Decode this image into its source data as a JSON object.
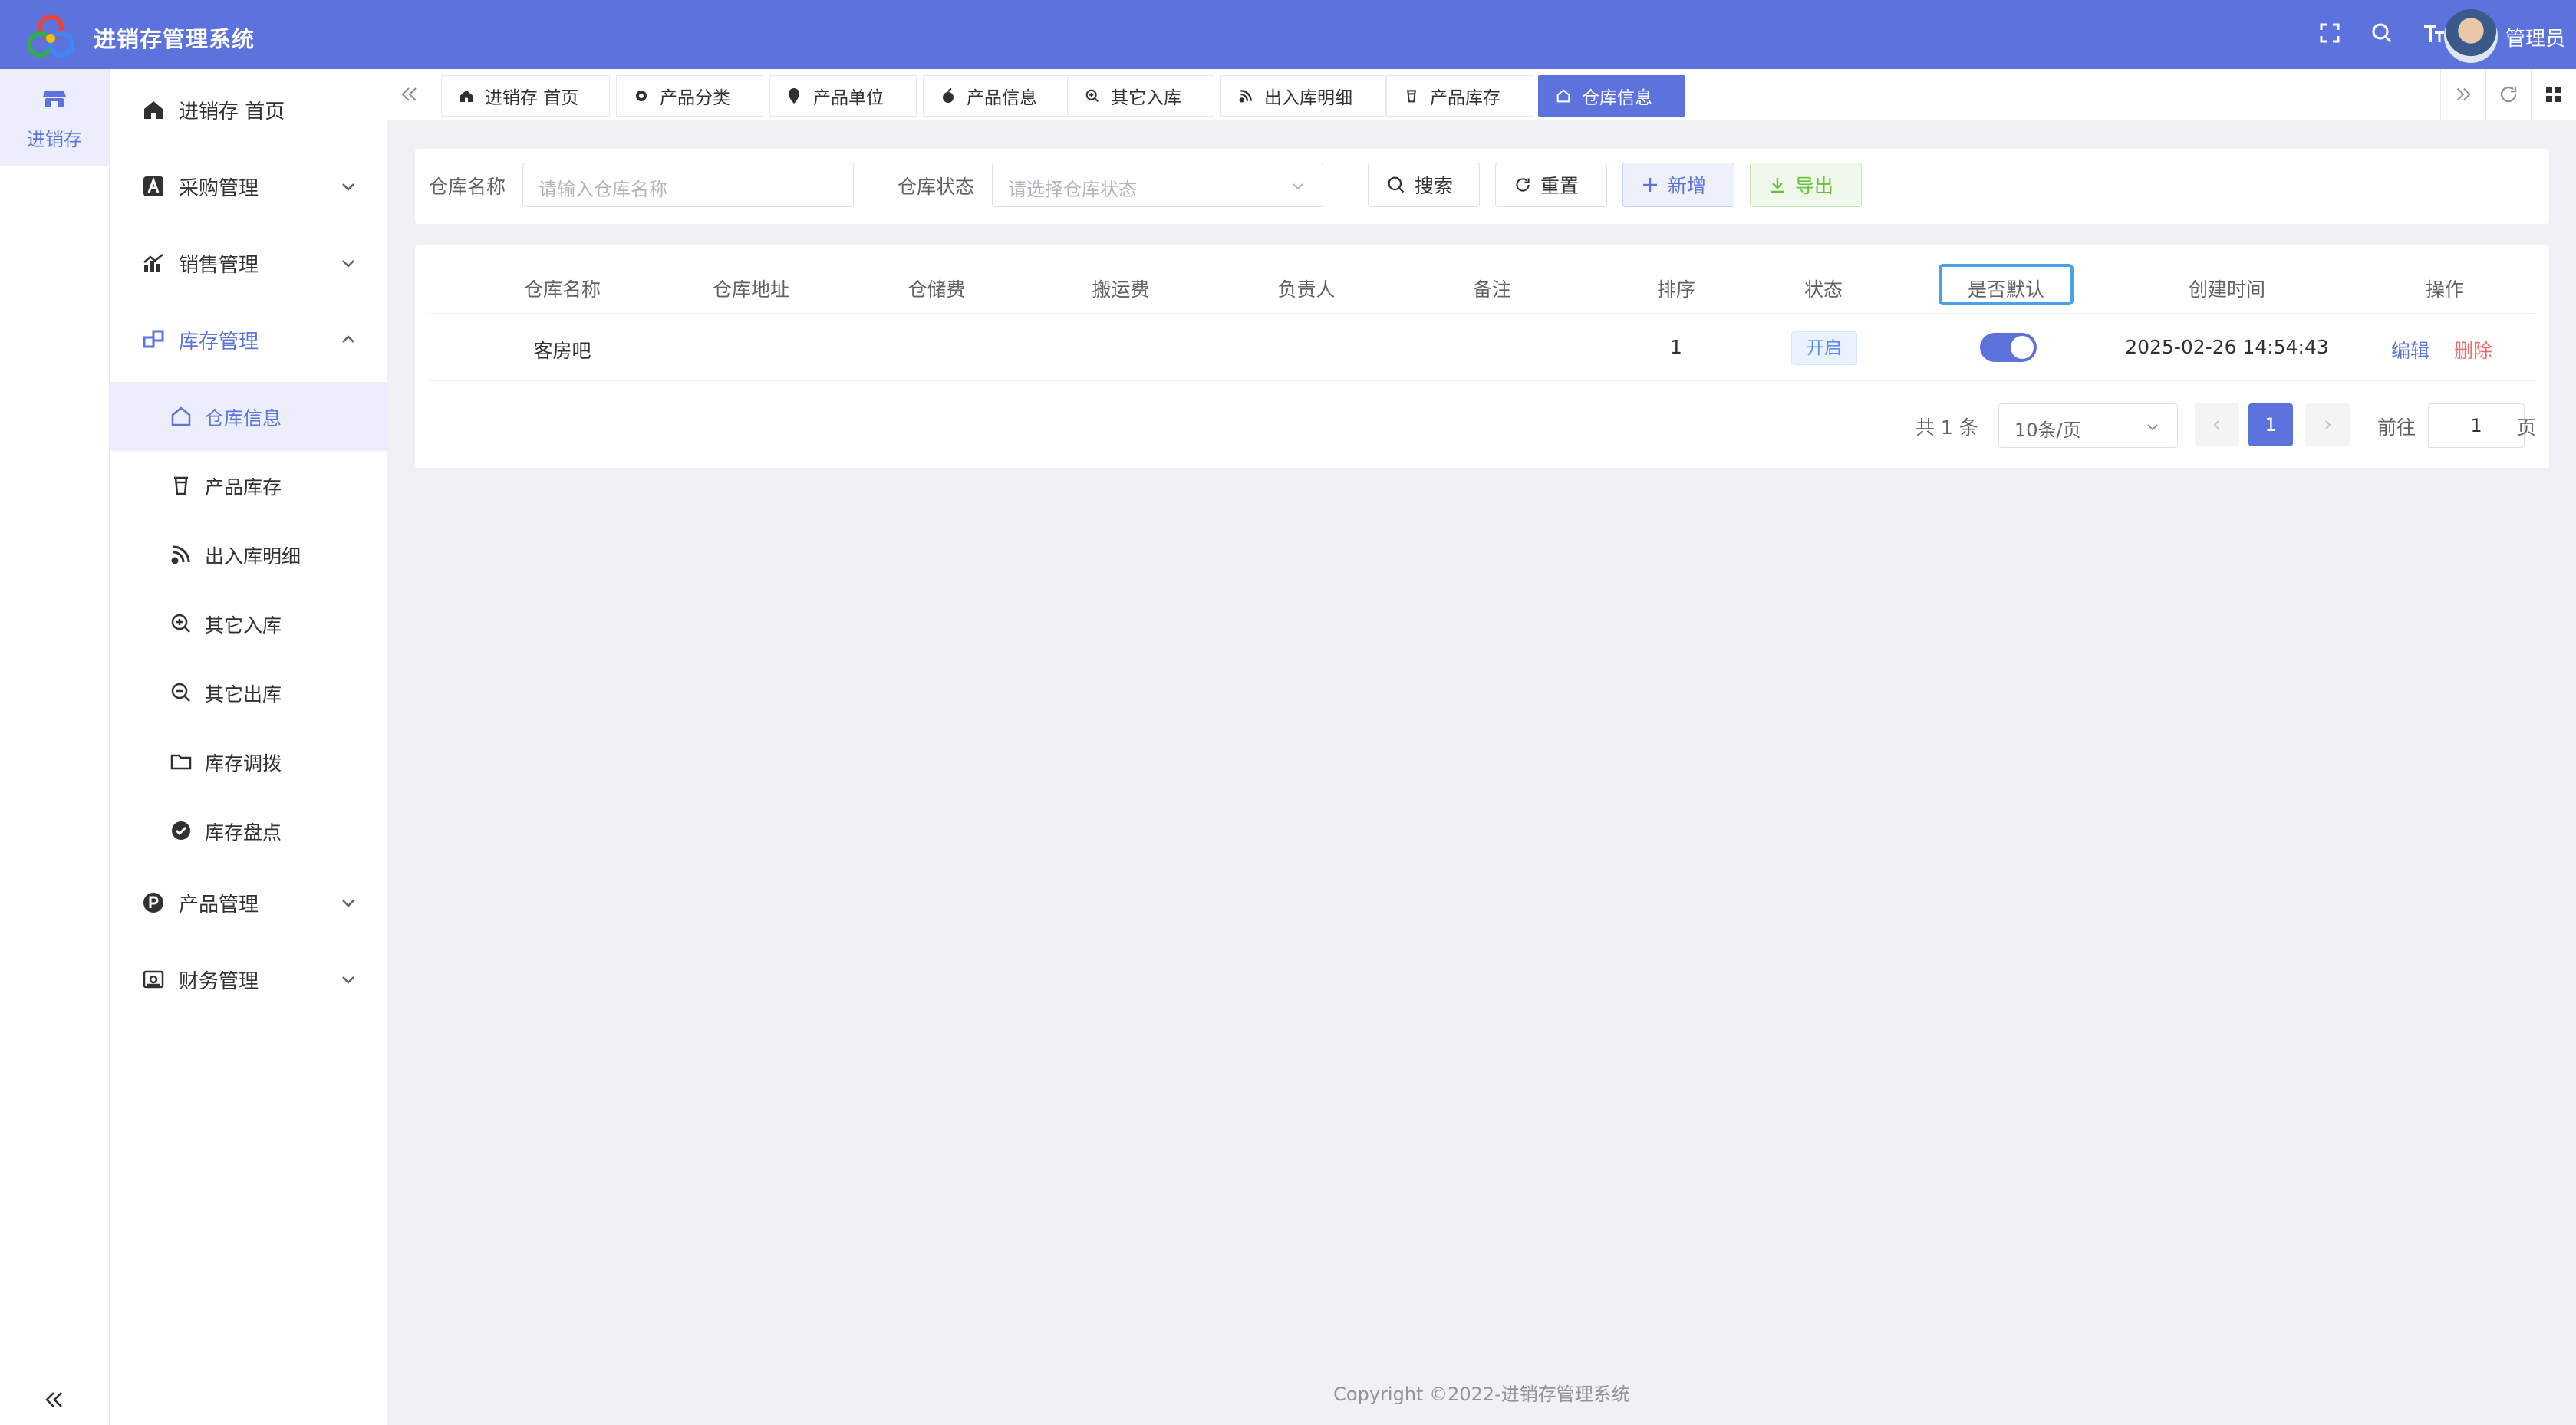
{
  "app": {
    "title": "进销存管理系统",
    "user": "管理员"
  },
  "rail": {
    "label": "进销存"
  },
  "sidebar": {
    "items": [
      {
        "label": "进销存 首页"
      },
      {
        "label": "采购管理"
      },
      {
        "label": "销售管理"
      },
      {
        "label": "库存管理"
      },
      {
        "label": "产品管理"
      },
      {
        "label": "财务管理"
      }
    ],
    "sub_items": [
      {
        "label": "仓库信息"
      },
      {
        "label": "产品库存"
      },
      {
        "label": "出入库明细"
      },
      {
        "label": "其它入库"
      },
      {
        "label": "其它出库"
      },
      {
        "label": "库存调拨"
      },
      {
        "label": "库存盘点"
      }
    ]
  },
  "tabs": [
    {
      "label": "进销存 首页"
    },
    {
      "label": "产品分类"
    },
    {
      "label": "产品单位"
    },
    {
      "label": "产品信息"
    },
    {
      "label": "其它入库"
    },
    {
      "label": "出入库明细"
    },
    {
      "label": "产品库存"
    },
    {
      "label": "仓库信息"
    }
  ],
  "search": {
    "name_label": "仓库名称",
    "name_placeholder": "请输入仓库名称",
    "status_label": "仓库状态",
    "status_placeholder": "请选择仓库状态",
    "search_btn": "搜索",
    "reset_btn": "重置",
    "add_btn": "新增",
    "export_btn": "导出"
  },
  "table": {
    "headers": [
      "仓库名称",
      "仓库地址",
      "仓储费",
      "搬运费",
      "负责人",
      "备注",
      "排序",
      "状态",
      "是否默认",
      "创建时间",
      "操作"
    ],
    "rows": [
      {
        "name": "客房吧",
        "address": "",
        "storage_fee": "",
        "handling_fee": "",
        "manager": "",
        "remark": "",
        "sort": "1",
        "status": "开启",
        "is_default": true,
        "created": "2025-02-26 14:54:43",
        "edit": "编辑",
        "delete": "删除"
      }
    ]
  },
  "pager": {
    "total": "共 1 条",
    "size": "10条/页",
    "current": "1",
    "goto_label": "前往",
    "goto_value": "1",
    "unit": "页"
  },
  "footer": "Copyright ©2022-进销存管理系统",
  "colors": {
    "primary": "#5c73de",
    "danger": "#f56c6c",
    "success": "#67c23a"
  }
}
